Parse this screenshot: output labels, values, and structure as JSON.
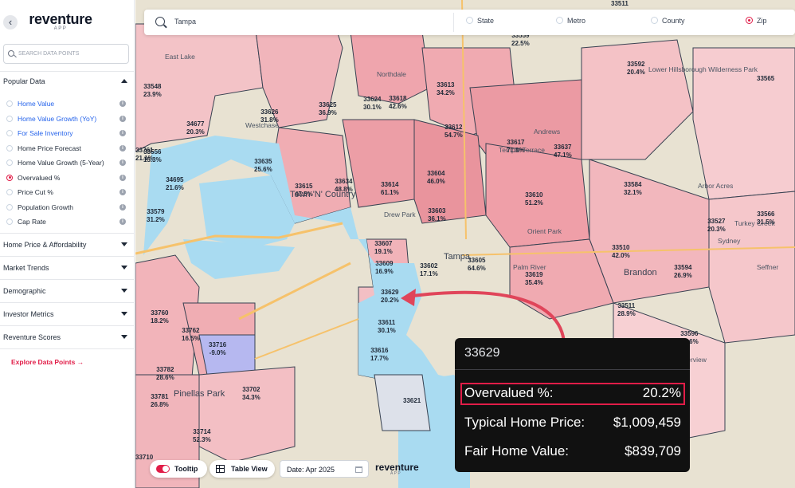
{
  "app": {
    "brand": "reventure",
    "brand_sub": "APP"
  },
  "sidebar": {
    "back_glyph": "‹",
    "search_placeholder": "SEARCH DATA POINTS",
    "popular_title": "Popular Data",
    "popular_items": [
      {
        "label": "Home Value",
        "color": "blue",
        "selected": false
      },
      {
        "label": "Home Value Growth (YoY)",
        "color": "blue",
        "selected": false
      },
      {
        "label": "For Sale Inventory",
        "color": "blue",
        "selected": false
      },
      {
        "label": "Home Price Forecast",
        "color": "default",
        "selected": false
      },
      {
        "label": "Home Value Growth (5-Year)",
        "color": "default",
        "selected": false
      },
      {
        "label": "Overvalued %",
        "color": "default",
        "selected": true
      },
      {
        "label": "Price Cut %",
        "color": "default",
        "selected": false
      },
      {
        "label": "Population Growth",
        "color": "default",
        "selected": false
      },
      {
        "label": "Cap Rate",
        "color": "default",
        "selected": false
      }
    ],
    "info_glyph": "i",
    "sections": [
      "Home Price & Affordability",
      "Market Trends",
      "Demographic",
      "Investor Metrics",
      "Reventure Scores"
    ],
    "explore_label": "Explore Data Points",
    "explore_arrow": "→"
  },
  "search": {
    "query": "Tampa"
  },
  "geo_options": [
    {
      "label": "State",
      "selected": false
    },
    {
      "label": "Metro",
      "selected": false
    },
    {
      "label": "County",
      "selected": false
    },
    {
      "label": "Zip",
      "selected": true
    }
  ],
  "controls": {
    "tooltip_label": "Tooltip",
    "tooltip_on": true,
    "table_label": "Table View",
    "date_label": "Date: Apr 2025"
  },
  "map": {
    "zips": [
      {
        "zip": "33548",
        "value": "23.9%"
      },
      {
        "zip": "33556",
        "value": "15.3%"
      },
      {
        "zip": "34677",
        "value": "20.3%"
      },
      {
        "zip": "33626",
        "value": "31.8%"
      },
      {
        "zip": "33625",
        "value": "36.9%"
      },
      {
        "zip": "33618",
        "value": "42.6%"
      },
      {
        "zip": "33624",
        "value": "30.1%"
      },
      {
        "zip": "33612",
        "value": "54.7%"
      },
      {
        "zip": "33613",
        "value": "34.2%"
      },
      {
        "zip": "33617",
        "value": "71.8%"
      },
      {
        "zip": "33637",
        "value": "47.1%"
      },
      {
        "zip": "33592",
        "value": "20.4%"
      },
      {
        "zip": "33559",
        "value": "22.5%"
      },
      {
        "zip": "34695",
        "value": "21.6%"
      },
      {
        "zip": "33635",
        "value": "25.6%"
      },
      {
        "zip": "33615",
        "value": "47.5%"
      },
      {
        "zip": "33634",
        "value": "48.8%"
      },
      {
        "zip": "33614",
        "value": "61.1%"
      },
      {
        "zip": "33604",
        "value": "46.0%"
      },
      {
        "zip": "33610",
        "value": "51.2%"
      },
      {
        "zip": "33584",
        "value": "32.1%"
      },
      {
        "zip": "33566",
        "value": "31.5%"
      },
      {
        "zip": "33527",
        "value": "20.3%"
      },
      {
        "zip": "33603",
        "value": "36.1%"
      },
      {
        "zip": "33607",
        "value": "19.1%"
      },
      {
        "zip": "33605",
        "value": "64.6%"
      },
      {
        "zip": "33510",
        "value": "42.0%"
      },
      {
        "zip": "33609",
        "value": "16.9%"
      },
      {
        "zip": "33602",
        "value": "17.1%"
      },
      {
        "zip": "33619",
        "value": "35.4%"
      },
      {
        "zip": "33594",
        "value": "26.9%"
      },
      {
        "zip": "33629",
        "value": "20.2%"
      },
      {
        "zip": "33760",
        "value": "18.2%"
      },
      {
        "zip": "33511",
        "value": "28.9%"
      },
      {
        "zip": "33611",
        "value": "30.1%"
      },
      {
        "zip": "33762",
        "value": "16.5%"
      },
      {
        "zip": "33716",
        "value": "-9.0%"
      },
      {
        "zip": "33616",
        "value": "17.7%"
      },
      {
        "zip": "33596",
        "value": "14.6%"
      },
      {
        "zip": "33782",
        "value": "28.6%"
      },
      {
        "zip": "33781",
        "value": "26.8%"
      },
      {
        "zip": "33702",
        "value": "34.3%"
      },
      {
        "zip": "33621",
        "value": ""
      },
      {
        "zip": "33714",
        "value": "52.3%"
      },
      {
        "zip": "33710",
        "value": ""
      },
      {
        "zip": "33761",
        "value": "21.1%"
      },
      {
        "zip": "33579",
        "value": "31.2%"
      },
      {
        "zip": "33511",
        "value": ""
      },
      {
        "zip": "33565",
        "value": ""
      }
    ],
    "places": [
      "East Lake",
      "Northdale",
      "Westchase",
      "Town 'N' Country",
      "Lower Hillsborough Wilderness Park",
      "Temple Terrace",
      "Andrews",
      "Brandon",
      "Riverview",
      "Sydney",
      "Turkey Creek",
      "Arbor Acres",
      "Drew Park",
      "Orient Park",
      "Palm River",
      "Pinellas Park",
      "Tampa",
      "Seffner"
    ]
  },
  "tooltip": {
    "zip": "33629",
    "rows": [
      {
        "label": "Overvalued %:",
        "value": "20.2%"
      },
      {
        "label": "Typical Home Price:",
        "value": "$1,009,459"
      },
      {
        "label": "Fair Home Value:",
        "value": "$839,709"
      }
    ]
  },
  "colors": {
    "accent": "#e11d48",
    "water": "#a9dbf1",
    "land": "#e8e2d2",
    "zip_fill": "#f1b3b9",
    "zip_fill_strong": "#e98e98",
    "negative": "#b6b8f0"
  }
}
